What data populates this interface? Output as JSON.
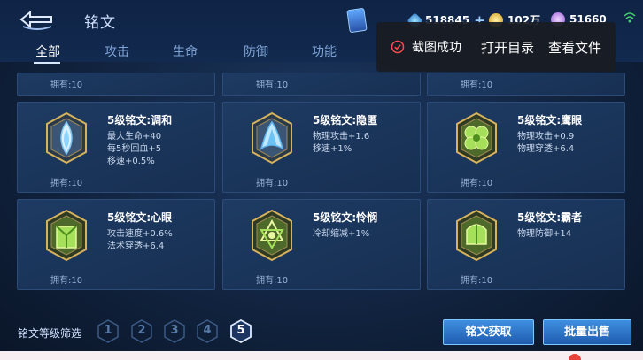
{
  "header": {
    "title": "铭文",
    "resources": [
      {
        "icon": "diamond-icon",
        "value": "518845",
        "plus": "+"
      },
      {
        "icon": "gold-coin-icon",
        "value": "102万"
      },
      {
        "icon": "crystal-icon",
        "value": "51660"
      }
    ]
  },
  "tabs": [
    {
      "label": "全部",
      "active": true
    },
    {
      "label": "攻击",
      "active": false
    },
    {
      "label": "生命",
      "active": false
    },
    {
      "label": "防御",
      "active": false
    },
    {
      "label": "功能",
      "active": false
    }
  ],
  "toast": {
    "message": "截图成功",
    "open_dir": "打开目录",
    "view_file": "查看文件"
  },
  "top_row": [
    {
      "owned": "拥有:10"
    },
    {
      "owned": "拥有:10"
    },
    {
      "owned": "拥有:10"
    }
  ],
  "cards": [
    {
      "name": "5级铭文:调和",
      "stats": [
        "最大生命+40",
        "每5秒回血+5",
        "移速+0.5%"
      ],
      "owned": "拥有:10",
      "color": "blue",
      "icon": "harmony-emblem-icon"
    },
    {
      "name": "5级铭文:隐匿",
      "stats": [
        "物理攻击+1.6",
        "移速+1%"
      ],
      "owned": "拥有:10",
      "color": "blue",
      "icon": "stealth-emblem-icon"
    },
    {
      "name": "5级铭文:鹰眼",
      "stats": [
        "物理攻击+0.9",
        "物理穿透+6.4"
      ],
      "owned": "拥有:10",
      "color": "green",
      "icon": "hawkeye-emblem-icon"
    },
    {
      "name": "5级铭文:心眼",
      "stats": [
        "攻击速度+0.6%",
        "法术穿透+6.4"
      ],
      "owned": "拥有:10",
      "color": "green",
      "icon": "mindeye-emblem-icon"
    },
    {
      "name": "5级铭文:怜悯",
      "stats": [
        "冷却缩减+1%"
      ],
      "owned": "拥有:10",
      "color": "green",
      "icon": "mercy-emblem-icon"
    },
    {
      "name": "5级铭文:霸者",
      "stats": [
        "物理防御+14"
      ],
      "owned": "拥有:10",
      "color": "green",
      "icon": "overlord-emblem-icon"
    }
  ],
  "footer": {
    "filter_label": "铭文等级筛选",
    "levels": [
      "1",
      "2",
      "3",
      "4",
      "5"
    ],
    "active_level": "5",
    "acquire_button": "铭文获取",
    "bulk_sell_button": "批量出售"
  }
}
